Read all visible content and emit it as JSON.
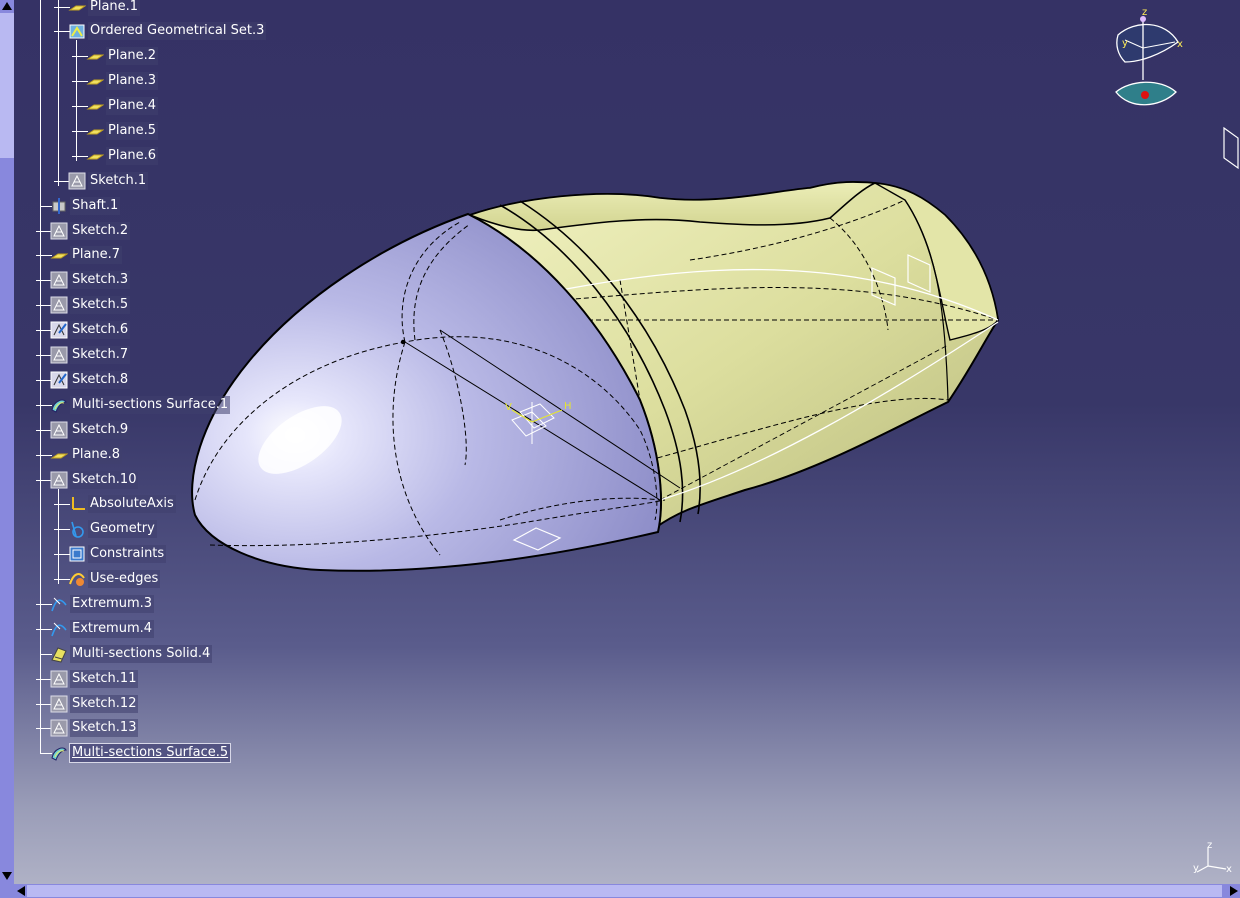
{
  "tree": {
    "nodes": [
      {
        "label": "Plane.1",
        "icon": "plane-icon"
      },
      {
        "label": "Ordered Geometrical Set.3",
        "icon": "ordered-geometrical-set-icon"
      },
      {
        "label": "Plane.2",
        "icon": "plane-icon"
      },
      {
        "label": "Plane.3",
        "icon": "plane-icon"
      },
      {
        "label": "Plane.4",
        "icon": "plane-icon"
      },
      {
        "label": "Plane.5",
        "icon": "plane-icon"
      },
      {
        "label": "Plane.6",
        "icon": "plane-icon"
      },
      {
        "label": "Sketch.1",
        "icon": "sketch-icon"
      },
      {
        "label": "Shaft.1",
        "icon": "shaft-icon"
      },
      {
        "label": "Sketch.2",
        "icon": "sketch-icon"
      },
      {
        "label": "Plane.7",
        "icon": "plane-icon"
      },
      {
        "label": "Sketch.3",
        "icon": "sketch-icon"
      },
      {
        "label": "Sketch.5",
        "icon": "sketch-icon"
      },
      {
        "label": "Sketch.6",
        "icon": "sketch-edit-icon"
      },
      {
        "label": "Sketch.7",
        "icon": "sketch-icon"
      },
      {
        "label": "Sketch.8",
        "icon": "sketch-edit-icon"
      },
      {
        "label": "Multi-sections Surface.1",
        "icon": "multi-sections-surface-icon"
      },
      {
        "label": "Sketch.9",
        "icon": "sketch-icon"
      },
      {
        "label": "Plane.8",
        "icon": "plane-icon"
      },
      {
        "label": "Sketch.10",
        "icon": "sketch-icon"
      },
      {
        "label": "AbsoluteAxis",
        "icon": "absolute-axis-icon"
      },
      {
        "label": "Geometry",
        "icon": "geometry-icon"
      },
      {
        "label": "Constraints",
        "icon": "constraints-icon"
      },
      {
        "label": "Use-edges",
        "icon": "use-edges-icon"
      },
      {
        "label": "Extremum.3",
        "icon": "extremum-icon"
      },
      {
        "label": "Extremum.4",
        "icon": "extremum-icon"
      },
      {
        "label": "Multi-sections Solid.4",
        "icon": "multi-sections-solid-icon"
      },
      {
        "label": "Sketch.11",
        "icon": "sketch-icon"
      },
      {
        "label": "Sketch.12",
        "icon": "sketch-icon"
      },
      {
        "label": "Sketch.13",
        "icon": "sketch-icon"
      },
      {
        "label": "Multi-sections Surface.5",
        "icon": "multi-sections-surface-icon"
      }
    ]
  },
  "compass": {
    "x_label": "x",
    "y_label": "y",
    "z_label": "z"
  },
  "mini_axis": {
    "x_label": "x",
    "y_label": "y",
    "z_label": "z"
  },
  "sketch_axis": {
    "v_label": "V",
    "h_label": "H"
  },
  "colors": {
    "background_top": "#353265",
    "background_bottom": "#b3b5c8",
    "surface_nose": "#c8c8f0",
    "solid_body": "#dcde9c",
    "scrollbar": "#8888dd",
    "selection": "#ffffff"
  }
}
